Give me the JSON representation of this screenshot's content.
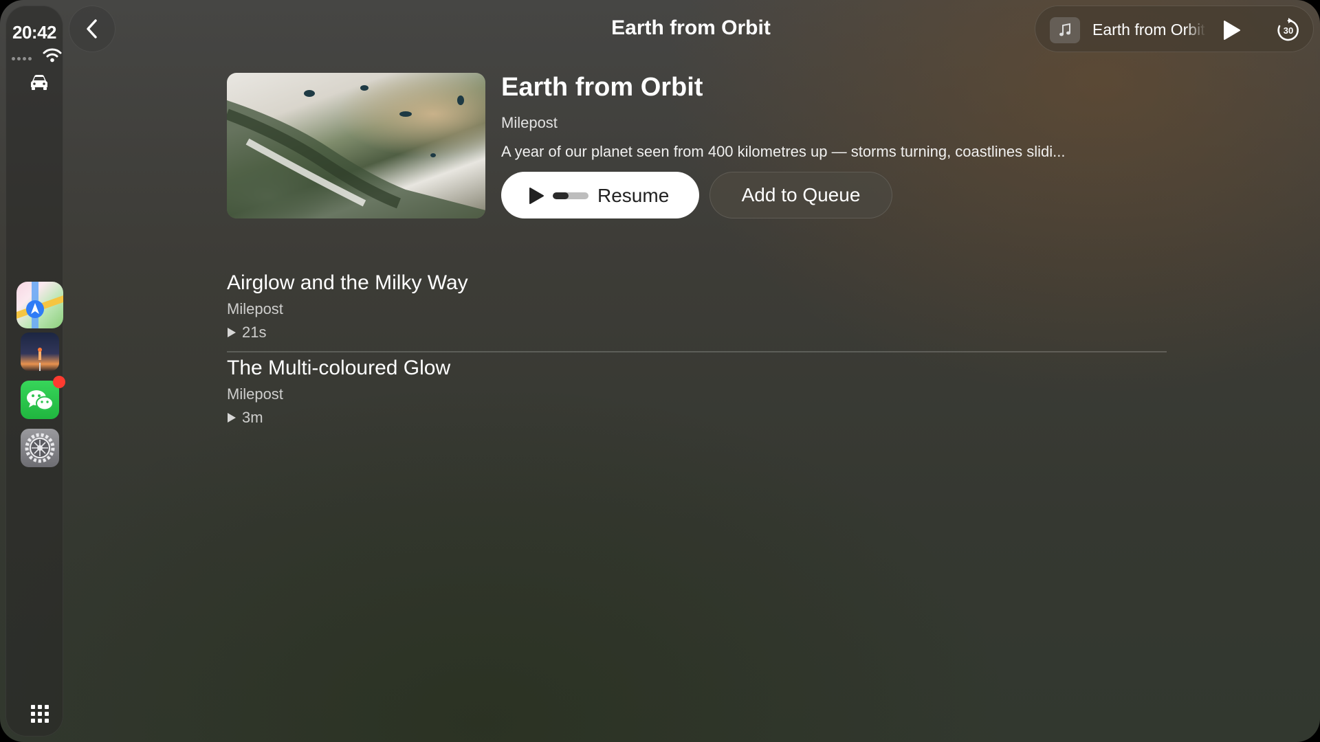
{
  "status": {
    "time": "20:42"
  },
  "header": {
    "title": "Earth from Orbit"
  },
  "now_playing": {
    "title": "Earth from Orbit"
  },
  "show": {
    "title": "Earth from Orbit",
    "author": "Milepost",
    "description": "A year of our planet seen from 400 kilometres up — storms turning, coastlines slidi...",
    "resume_label": "Resume",
    "resume_progress": 0.45,
    "queue_label": "Add to Queue"
  },
  "episodes": [
    {
      "title": "Airglow and the Milky Way",
      "author": "Milepost",
      "duration": "21s"
    },
    {
      "title": "The Multi-coloured Glow",
      "author": "Milepost",
      "duration": "3m"
    }
  ],
  "skip_seconds": "30",
  "colors": {
    "accent": "#ffffff",
    "badge": "#ff3b30",
    "wechat": "#2ecc55"
  },
  "icons": {
    "back": "chevron-left-icon",
    "music": "music-note-icon",
    "play": "play-icon",
    "skip": "skip-forward-30-icon",
    "wifi": "wifi-icon",
    "car": "car-icon",
    "grid": "app-grid-icon"
  }
}
